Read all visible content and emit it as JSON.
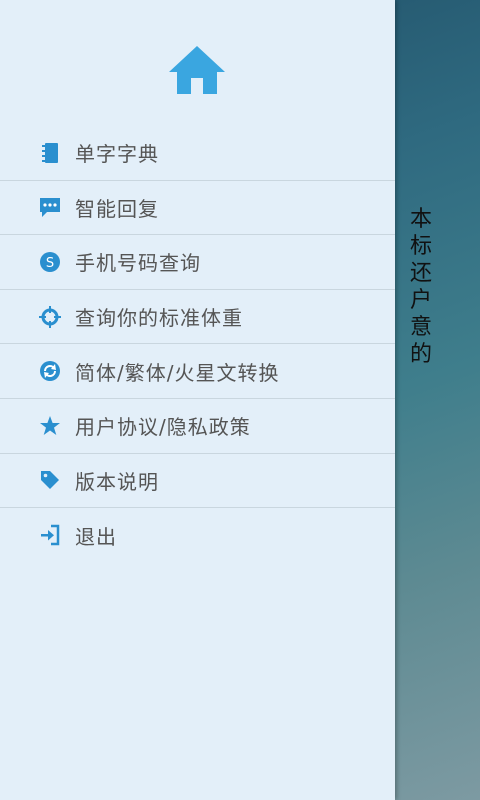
{
  "background": {
    "text_lines": [
      "本",
      "标",
      "还",
      "户",
      "意",
      "的"
    ]
  },
  "drawer": {
    "home_icon": "home-icon",
    "items": [
      {
        "label": "单字字典",
        "icon": "book-icon"
      },
      {
        "label": "智能回复",
        "icon": "chat-icon"
      },
      {
        "label": "手机号码查询",
        "icon": "skype-icon"
      },
      {
        "label": "查询你的标准体重",
        "icon": "crosshair-icon"
      },
      {
        "label": "简体/繁体/火星文转换",
        "icon": "refresh-icon"
      },
      {
        "label": "用户协议/隐私政策",
        "icon": "star-icon"
      },
      {
        "label": "版本说明",
        "icon": "tag-icon"
      },
      {
        "label": "退出",
        "icon": "sign-in-icon"
      }
    ]
  },
  "colors": {
    "accent": "#3aa6e0",
    "drawer_bg": "#e3eff9",
    "label": "#555555"
  }
}
